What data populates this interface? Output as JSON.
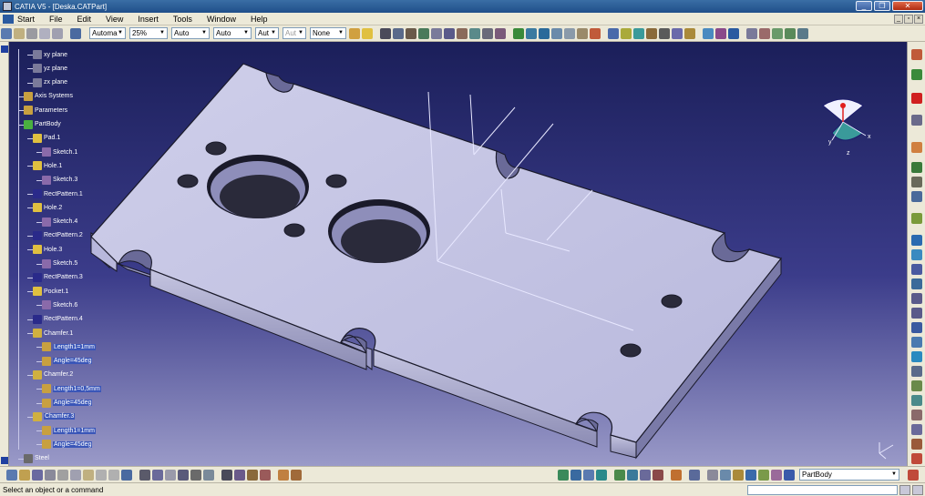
{
  "window": {
    "title": "CATIA V5 - [Deska.CATPart]"
  },
  "menubar": {
    "items": [
      {
        "label": "Start"
      },
      {
        "label": "File"
      },
      {
        "label": "Edit"
      },
      {
        "label": "View"
      },
      {
        "label": "Insert"
      },
      {
        "label": "Tools"
      },
      {
        "label": "Window"
      },
      {
        "label": "Help"
      }
    ]
  },
  "toolbar": {
    "combos": [
      {
        "value": "Automa"
      },
      {
        "value": "25%"
      },
      {
        "value": "Auto"
      },
      {
        "value": "Auto"
      },
      {
        "value": "Aut"
      },
      {
        "value": "Aut"
      },
      {
        "value": "None"
      }
    ],
    "accent": "#ece9d8"
  },
  "tree": {
    "nodes": [
      {
        "label": "xy plane",
        "icon": "plane-icon",
        "hl": false
      },
      {
        "label": "yz plane",
        "icon": "plane-icon",
        "hl": false
      },
      {
        "label": "zx plane",
        "icon": "plane-icon",
        "hl": false
      },
      {
        "label": "Axis Systems",
        "icon": "axis-system-icon",
        "hl": false
      },
      {
        "label": "Parameters",
        "icon": "parameters-icon",
        "hl": false
      },
      {
        "label": "PartBody",
        "icon": "partbody-icon",
        "hl": false
      },
      {
        "label": "Pad.1",
        "icon": "pad-icon",
        "hl": false
      },
      {
        "label": "Sketch.1",
        "icon": "sketch-icon",
        "hl": false
      },
      {
        "label": "Hole.1",
        "icon": "hole-icon",
        "hl": false
      },
      {
        "label": "Sketch.3",
        "icon": "sketch-icon",
        "hl": false
      },
      {
        "label": "RectPattern.1",
        "icon": "rectpattern-icon",
        "hl": false
      },
      {
        "label": "Hole.2",
        "icon": "hole-icon",
        "hl": false
      },
      {
        "label": "Sketch.4",
        "icon": "sketch-icon",
        "hl": false
      },
      {
        "label": "RectPattern.2",
        "icon": "rectpattern-icon",
        "hl": false
      },
      {
        "label": "Hole.3",
        "icon": "hole-icon",
        "hl": false
      },
      {
        "label": "Sketch.5",
        "icon": "sketch-icon",
        "hl": false
      },
      {
        "label": "RectPattern.3",
        "icon": "rectpattern-icon",
        "hl": false
      },
      {
        "label": "Pocket.1",
        "icon": "pocket-icon",
        "hl": false
      },
      {
        "label": "Sketch.6",
        "icon": "sketch-icon",
        "hl": false
      },
      {
        "label": "RectPattern.4",
        "icon": "rectpattern-icon",
        "hl": false
      },
      {
        "label": "Chamfer.1",
        "icon": "chamfer-icon",
        "hl": false
      },
      {
        "label": "Length1=1mm",
        "icon": "param-icon",
        "hl": true
      },
      {
        "label": "Angle=45deg",
        "icon": "param-icon",
        "hl": true
      },
      {
        "label": "Chamfer.2",
        "icon": "chamfer-icon",
        "hl": false
      },
      {
        "label": "Length1=0,5mm",
        "icon": "param-icon",
        "hl": true
      },
      {
        "label": "Angle=45deg",
        "icon": "param-icon",
        "hl": true
      },
      {
        "label": "Chamfer.3",
        "icon": "chamfer-icon",
        "hl": true
      },
      {
        "label": "Length1=1mm",
        "icon": "param-icon",
        "hl": true
      },
      {
        "label": "Angle=45deg",
        "icon": "param-icon",
        "hl": true
      },
      {
        "label": "Steel",
        "icon": "material-icon",
        "hl": false
      }
    ]
  },
  "compass": {
    "x_label": "x",
    "y_label": "y",
    "z_label": "z"
  },
  "bottom": {
    "part_combo": "PartBody"
  },
  "status": {
    "message": "Select an object or a command"
  },
  "colors": {
    "viewport_top": "#1b1f5a",
    "viewport_bottom": "#9a9ac8",
    "part_face": "#c9c9e6",
    "part_side": "#a8a8cc",
    "part_edge": "#1a1a2a"
  }
}
